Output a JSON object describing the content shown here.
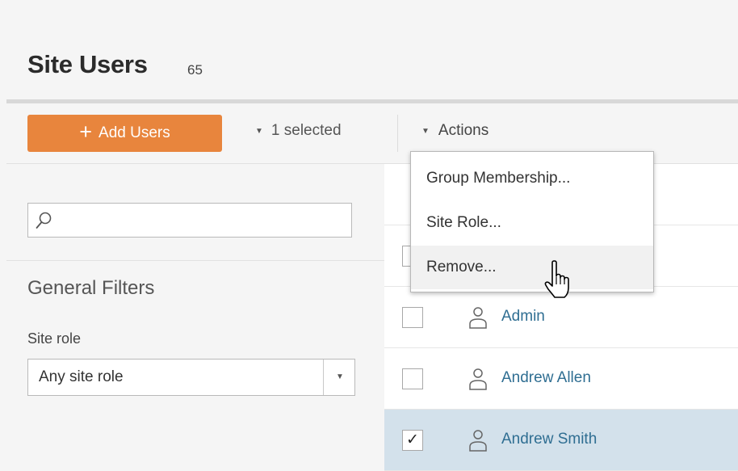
{
  "header": {
    "title": "Site Users",
    "count": "65"
  },
  "toolbar": {
    "add_users_icon": "+",
    "add_users_label": "Add Users",
    "caret_icon": "▼",
    "selected_label": "1 selected",
    "actions_label": "Actions"
  },
  "sidebar": {
    "search": {
      "value": "",
      "placeholder": ""
    },
    "filters_title": "General Filters",
    "site_role_label": "Site role",
    "site_role_value": "Any site role"
  },
  "actions_menu": {
    "items": [
      {
        "label": "Group Membership..."
      },
      {
        "label": "Site Role..."
      },
      {
        "label": "Remove..."
      }
    ],
    "hovered": "Remove..."
  },
  "users": [
    {
      "name": "Admin",
      "checked": false,
      "check_glyph": ""
    },
    {
      "name": "Andrew Allen",
      "checked": false,
      "check_glyph": ""
    },
    {
      "name": "Andrew Smith",
      "checked": true,
      "check_glyph": "✓"
    }
  ],
  "colors": {
    "accent_orange": "#e8853d",
    "link_blue": "#2f6e92",
    "selected_row": "#d3e1eb",
    "background": "#f5f5f5"
  },
  "icons": [
    "plus-icon",
    "caret-down-icon",
    "search-icon",
    "user-icon",
    "hand-cursor-icon"
  ]
}
